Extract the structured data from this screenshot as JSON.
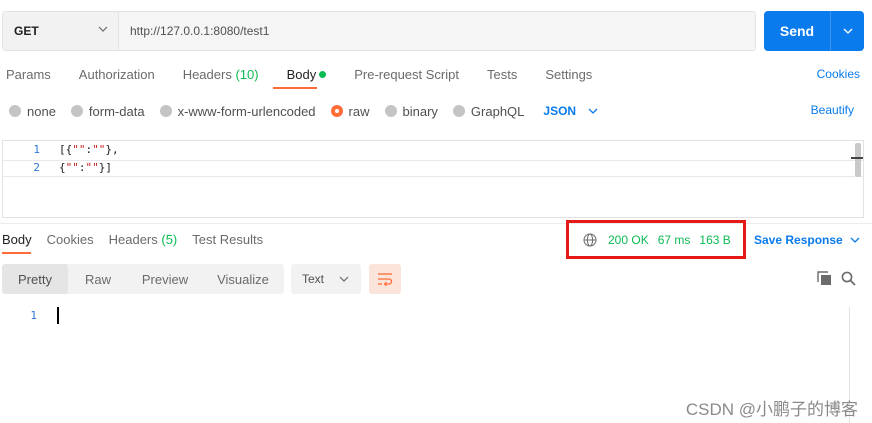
{
  "request": {
    "method": "GET",
    "url": "http://127.0.0.1:8080/test1",
    "send_label": "Send"
  },
  "req_tabs": {
    "params": "Params",
    "authorization": "Authorization",
    "headers": "Headers",
    "headers_count": "(10)",
    "body": "Body",
    "prerequest": "Pre-request Script",
    "tests": "Tests",
    "settings": "Settings",
    "cookies": "Cookies"
  },
  "body_types": {
    "none": "none",
    "form_data": "form-data",
    "urlencoded": "x-www-form-urlencoded",
    "raw": "raw",
    "binary": "binary",
    "graphql": "GraphQL",
    "format": "JSON",
    "beautify": "Beautify"
  },
  "editor": {
    "lines": [
      {
        "num": "1",
        "pre": "[{",
        "str": "\"\"",
        "mid": ":",
        "str2": "\"\"",
        "post": "},"
      },
      {
        "num": "2",
        "pre": "{",
        "str": "\"\"",
        "mid": ":",
        "str2": "\"\"",
        "post": "}]"
      }
    ]
  },
  "response": {
    "tabs": {
      "body": "Body",
      "cookies": "Cookies",
      "headers": "Headers",
      "headers_count": "(5)",
      "test_results": "Test Results"
    },
    "status": "200 OK",
    "time": "67 ms",
    "size": "163 B",
    "save_label": "Save Response",
    "views": [
      "Pretty",
      "Raw",
      "Preview",
      "Visualize"
    ],
    "text_format": "Text",
    "line_num": "1"
  },
  "colors": {
    "accent": "#ff6c37",
    "link": "#097bed",
    "status_green": "#0cbb52",
    "highlight_box": "#e61919"
  },
  "watermark": "CSDN @小鹏子的博客"
}
